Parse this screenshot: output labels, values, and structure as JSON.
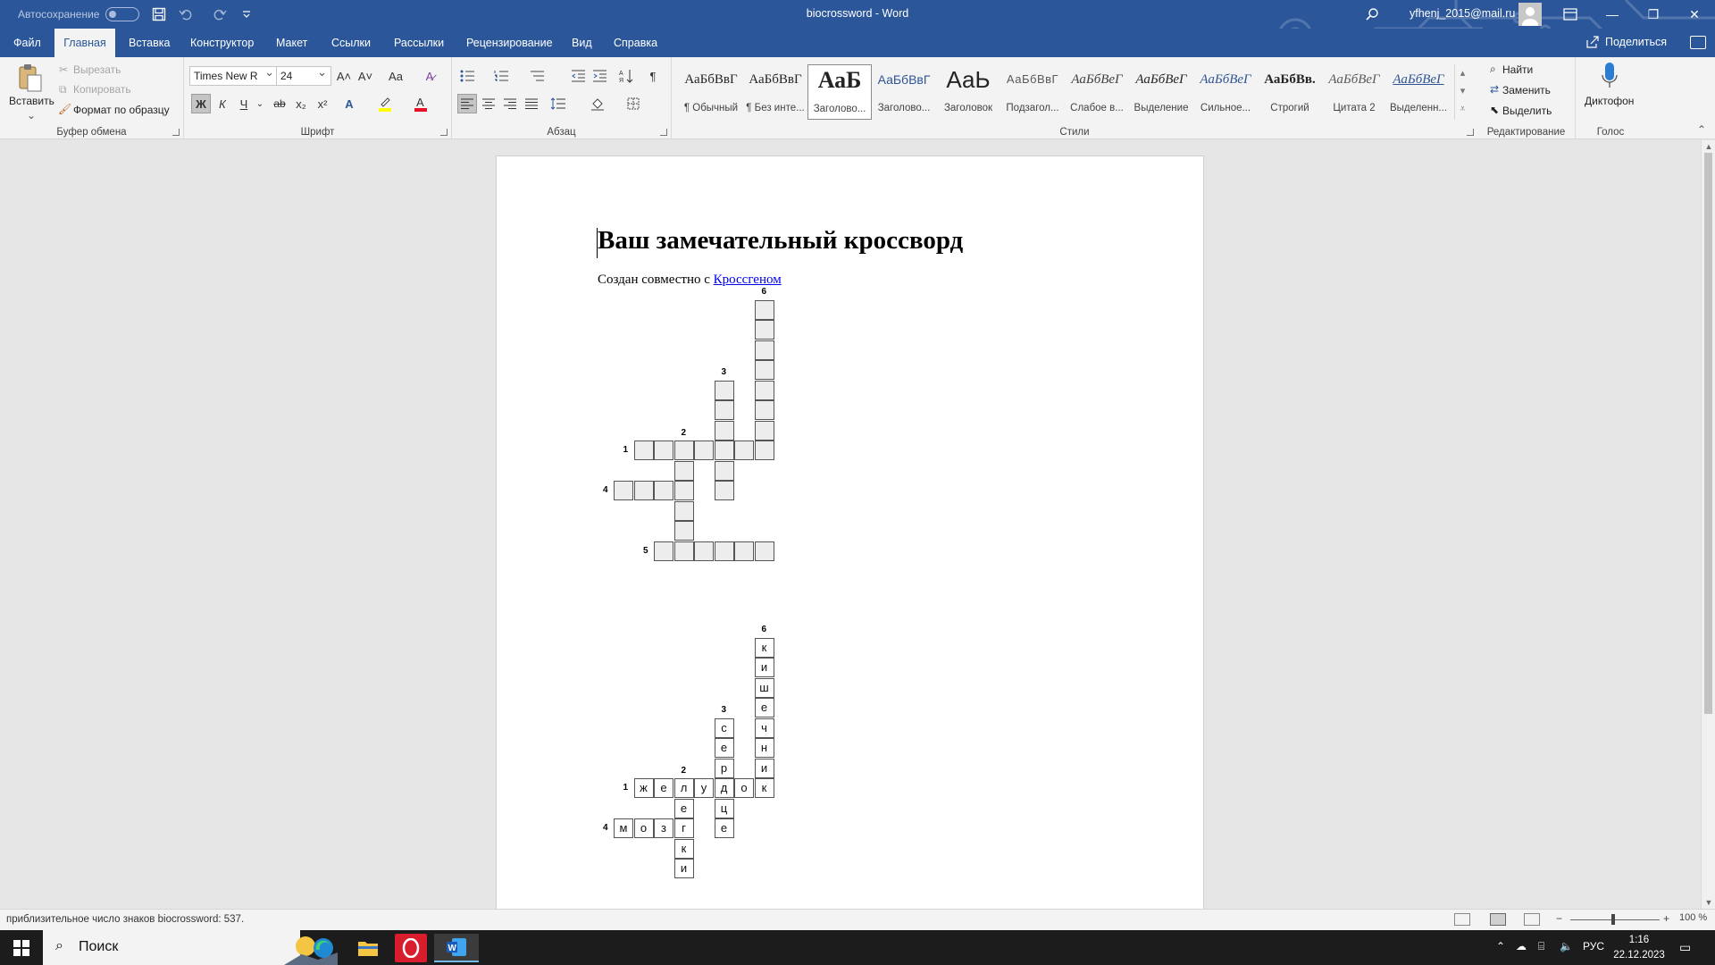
{
  "titlebar": {
    "autosave_label": "Автосохранение",
    "doc_title": "biocrossword  -  Word",
    "user_email": "yfhenj_2015@mail.ru",
    "minimize": "—",
    "restore": "❐",
    "close": "✕"
  },
  "tabs": [
    "Файл",
    "Главная",
    "Вставка",
    "Конструктор",
    "Макет",
    "Ссылки",
    "Рассылки",
    "Рецензирование",
    "Вид",
    "Справка"
  ],
  "share_label": "Поделиться",
  "clipboard": {
    "paste": "Вставить",
    "cut": "Вырезать",
    "copy": "Копировать",
    "format_painter": "Формат по образцу",
    "label": "Буфер обмена"
  },
  "font": {
    "name": "Times New R",
    "size": "24",
    "label": "Шрифт",
    "grow": "A˄",
    "shrink": "A˅",
    "case": "Aa",
    "bold": "Ж",
    "italic": "К",
    "underline": "Ч",
    "strike": "ab",
    "sub": "x₂",
    "sup": "x²"
  },
  "paragraph": {
    "label": "Абзац",
    "pilcrow": "¶"
  },
  "styles": {
    "label": "Стили",
    "items": [
      {
        "preview": "АаБбВвГ",
        "name": "¶ Обычный"
      },
      {
        "preview": "АаБбВвГ",
        "name": "¶ Без инте..."
      },
      {
        "preview": "АаБ",
        "name": "Заголово..."
      },
      {
        "preview": "АаБбВвГ",
        "name": "Заголово..."
      },
      {
        "preview": "АаЬ",
        "name": "Заголовок"
      },
      {
        "preview": "АаБбВвГ",
        "name": "Подзагол..."
      },
      {
        "preview": "АаБбВеГ",
        "name": "Слабое в..."
      },
      {
        "preview": "АаБбВеГ",
        "name": "Выделение"
      },
      {
        "preview": "АаБбВеГ",
        "name": "Сильное..."
      },
      {
        "preview": "АаБбВв.",
        "name": "Строгий"
      },
      {
        "preview": "АаБбВеГ",
        "name": "Цитата 2"
      },
      {
        "preview": "АаБбВеГ",
        "name": "Выделенн..."
      }
    ]
  },
  "editing": {
    "find": "Найти",
    "replace": "Заменить",
    "select": "Выделить",
    "label": "Редактирование"
  },
  "voice": {
    "dictate": "Диктофон",
    "label": "Голос"
  },
  "document": {
    "title": "Ваш замечательный кроссворд",
    "subtitle_prefix": "Создан совместно с ",
    "subtitle_link": "Кроссгеном",
    "puzzle_empty": {
      "numbers": [
        {
          "n": "6",
          "row": 0,
          "col": 7
        },
        {
          "n": "3",
          "row": 4,
          "col": 5
        },
        {
          "n": "2",
          "row": 7,
          "col": 3
        },
        {
          "n": "1",
          "row": 8,
          "col": 0
        },
        {
          "n": "4",
          "row": 10,
          "col": -1
        },
        {
          "n": "5",
          "row": 13,
          "col": 1
        }
      ],
      "cells": [
        [
          1,
          7
        ],
        [
          2,
          7
        ],
        [
          3,
          7
        ],
        [
          4,
          7
        ],
        [
          5,
          7
        ],
        [
          6,
          7
        ],
        [
          7,
          7
        ],
        [
          8,
          7
        ],
        [
          5,
          5
        ],
        [
          6,
          5
        ],
        [
          7,
          5
        ],
        [
          8,
          5
        ],
        [
          9,
          5
        ],
        [
          10,
          5
        ],
        [
          8,
          1
        ],
        [
          8,
          2
        ],
        [
          8,
          3
        ],
        [
          8,
          4
        ],
        [
          8,
          6
        ],
        [
          9,
          3
        ],
        [
          10,
          3
        ],
        [
          11,
          3
        ],
        [
          12,
          3
        ],
        [
          13,
          3
        ],
        [
          10,
          0
        ],
        [
          10,
          1
        ],
        [
          10,
          2
        ],
        [
          13,
          2
        ],
        [
          13,
          4
        ],
        [
          13,
          5
        ],
        [
          13,
          6
        ],
        [
          13,
          7
        ]
      ]
    },
    "puzzle_answers": {
      "numbers": [
        {
          "n": "6",
          "row": 0,
          "col": 7
        },
        {
          "n": "3",
          "row": 4,
          "col": 5
        },
        {
          "n": "2",
          "row": 7,
          "col": 3
        },
        {
          "n": "1",
          "row": 8,
          "col": 0
        },
        {
          "n": "4",
          "row": 10,
          "col": -1
        }
      ],
      "cells": [
        [
          1,
          7,
          "к"
        ],
        [
          2,
          7,
          "и"
        ],
        [
          3,
          7,
          "ш"
        ],
        [
          4,
          7,
          "е"
        ],
        [
          5,
          7,
          "ч"
        ],
        [
          6,
          7,
          "н"
        ],
        [
          7,
          7,
          "и"
        ],
        [
          8,
          7,
          "к"
        ],
        [
          5,
          5,
          "с"
        ],
        [
          6,
          5,
          "е"
        ],
        [
          7,
          5,
          "р"
        ],
        [
          8,
          5,
          "д"
        ],
        [
          9,
          5,
          "ц"
        ],
        [
          10,
          5,
          "е"
        ],
        [
          8,
          1,
          "ж"
        ],
        [
          8,
          2,
          "е"
        ],
        [
          8,
          3,
          "л"
        ],
        [
          8,
          4,
          "у"
        ],
        [
          8,
          6,
          "о"
        ],
        [
          9,
          3,
          "е"
        ],
        [
          10,
          3,
          "г"
        ],
        [
          11,
          3,
          "к"
        ],
        [
          12,
          3,
          "и"
        ],
        [
          10,
          0,
          "м"
        ],
        [
          10,
          1,
          "о"
        ],
        [
          10,
          2,
          "з"
        ]
      ]
    }
  },
  "status": {
    "text": "приблизительное число знаков biocrossword: 537.",
    "zoom": "100 %"
  },
  "taskbar": {
    "search": "Поиск",
    "lang": "РУС",
    "time": "1:16",
    "date": "22.12.2023"
  }
}
